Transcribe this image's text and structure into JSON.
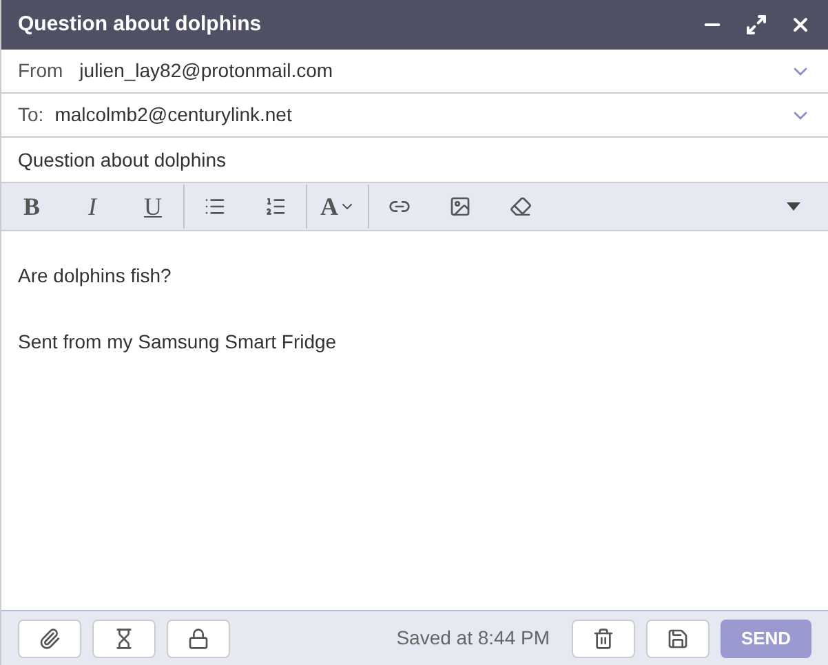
{
  "window": {
    "title": "Question about dolphins"
  },
  "from": {
    "label": "From",
    "value": "julien_lay82@protonmail.com"
  },
  "to": {
    "label": "To:",
    "value": "malcolmb2@centurylink.net"
  },
  "subject": {
    "value": "Question about dolphins"
  },
  "toolbar": [
    {
      "kind": "bold",
      "label": "B"
    },
    {
      "kind": "italic",
      "label": "I"
    },
    {
      "kind": "underline",
      "label": "U"
    },
    {
      "kind": "divider"
    },
    {
      "kind": "bullets"
    },
    {
      "kind": "numbers"
    },
    {
      "kind": "divider"
    },
    {
      "kind": "font",
      "label": "A"
    },
    {
      "kind": "divider"
    },
    {
      "kind": "link"
    },
    {
      "kind": "image"
    },
    {
      "kind": "eraser"
    }
  ],
  "body": [
    "Are dolphins fish?",
    "Sent from my Samsung Smart Fridge"
  ],
  "footer": {
    "status": "Saved at 8:44 PM",
    "send": "SEND"
  }
}
